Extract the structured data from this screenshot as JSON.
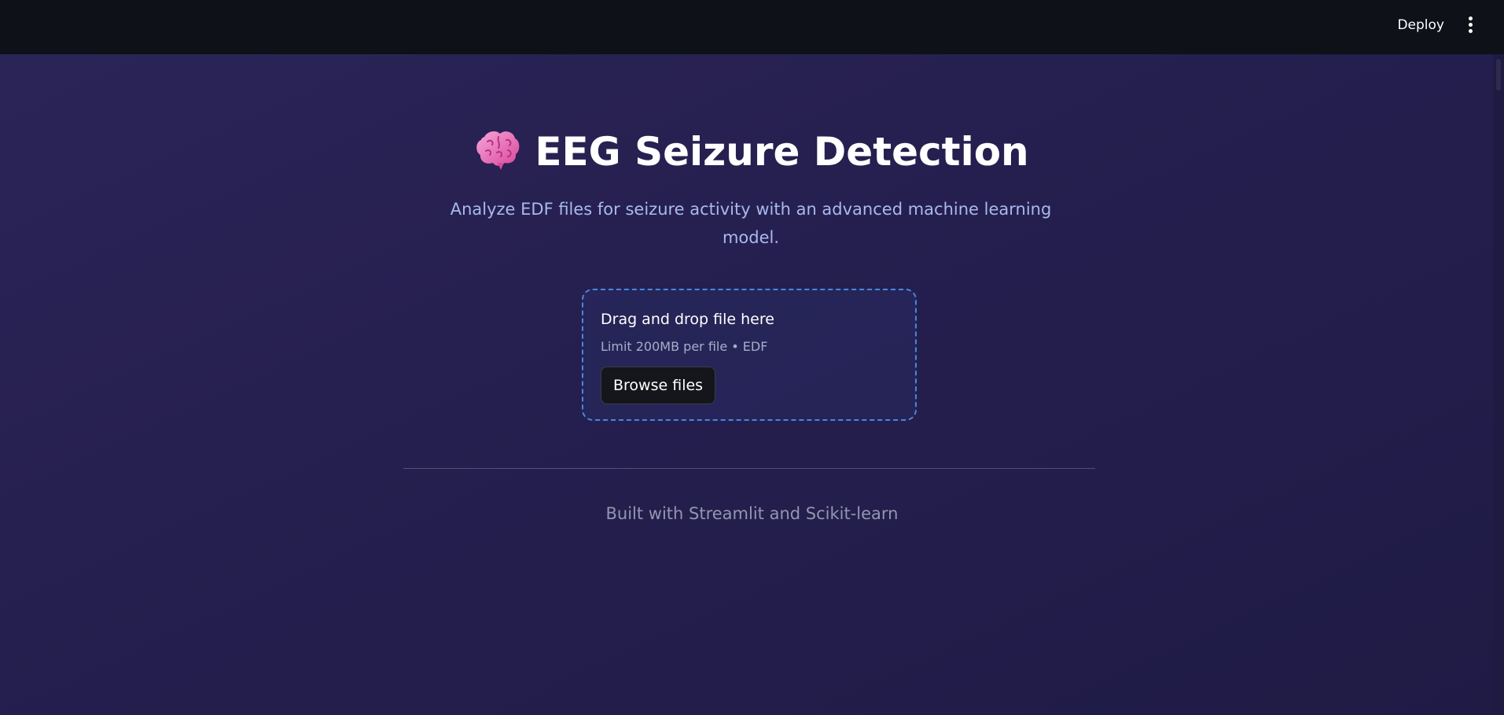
{
  "header": {
    "deploy_label": "Deploy",
    "menu_icon": "more-vertical-icon"
  },
  "main": {
    "title_icon": "brain-emoji-icon",
    "title": "EEG Seizure Detection",
    "subtitle": "Analyze EDF files for seizure activity with an advanced machine learning model."
  },
  "uploader": {
    "drop_label": "Drag and drop file here",
    "limit_label": "Limit 200MB per file • EDF",
    "browse_label": "Browse files"
  },
  "footer": {
    "text": "Built with Streamlit and Scikit-learn"
  },
  "colors": {
    "background": "#272150",
    "topbar": "#0e1118",
    "subtitle": "#a9b9ee",
    "uploader_border": "#4a86e0",
    "button_bg": "#14161c",
    "footer_text": "#9296b0"
  }
}
